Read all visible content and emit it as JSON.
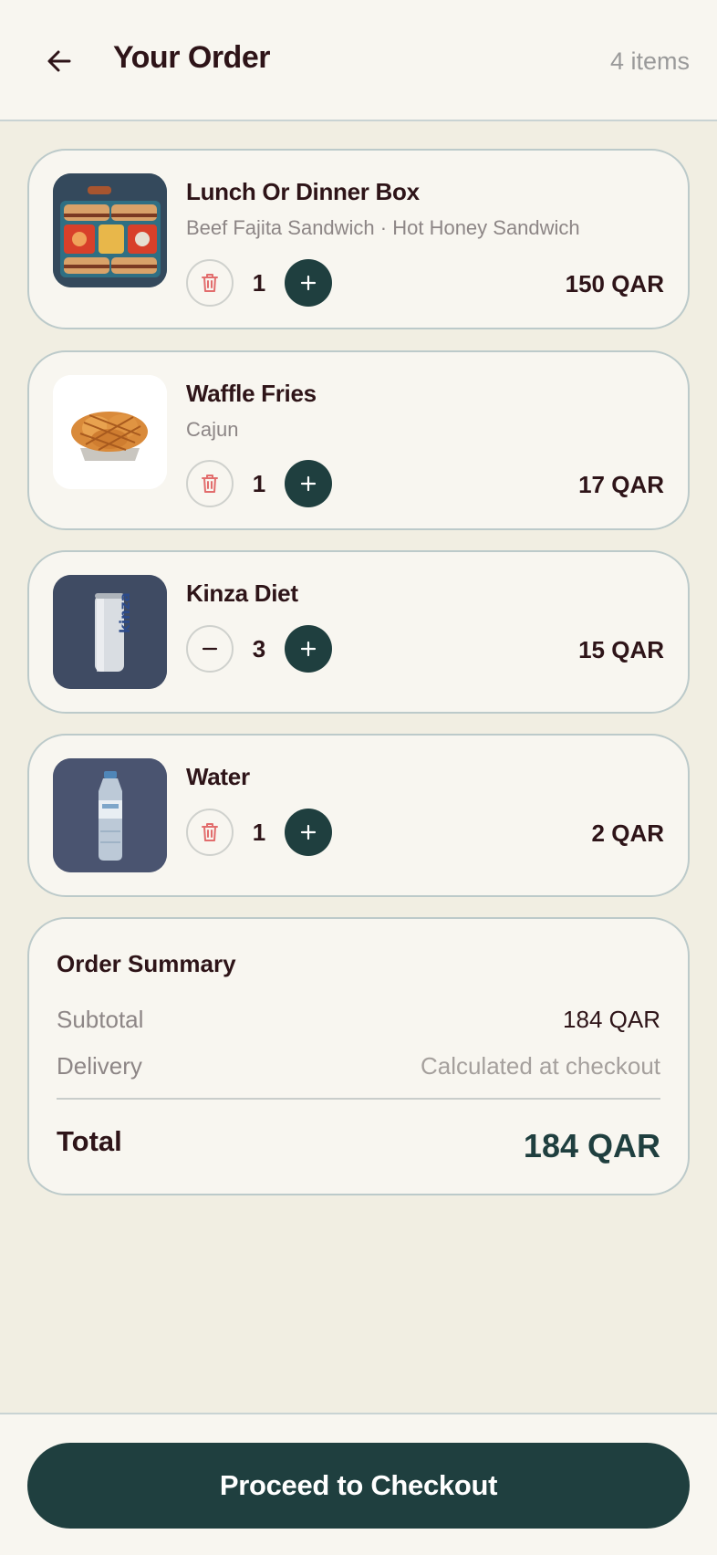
{
  "header": {
    "title": "Your Order",
    "item_count": "4 items"
  },
  "cart": {
    "items": [
      {
        "name": "Lunch Or Dinner Box",
        "description": "Beef Fajita Sandwich · Hot Honey Sandwich",
        "quantity": "1",
        "price": "150 QAR",
        "decrement_icon": "trash-icon"
      },
      {
        "name": "Waffle Fries",
        "description": "Cajun",
        "quantity": "1",
        "price": "17 QAR",
        "decrement_icon": "trash-icon"
      },
      {
        "name": "Kinza Diet",
        "description": "",
        "quantity": "3",
        "price": "15 QAR",
        "decrement_icon": "minus-icon"
      },
      {
        "name": "Water",
        "description": "",
        "quantity": "1",
        "price": "2 QAR",
        "decrement_icon": "trash-icon"
      }
    ]
  },
  "summary": {
    "title": "Order Summary",
    "subtotal_label": "Subtotal",
    "subtotal_value": "184 QAR",
    "delivery_label": "Delivery",
    "delivery_value": "Calculated at checkout",
    "total_label": "Total",
    "total_value": "184 QAR"
  },
  "footer": {
    "checkout_label": "Proceed to Checkout"
  },
  "colors": {
    "primary": "#1f3f3f",
    "background": "#f1eee2",
    "surface": "#f8f6f0",
    "text": "#2e1418",
    "muted": "#8d8686",
    "danger": "#e26d6d"
  }
}
